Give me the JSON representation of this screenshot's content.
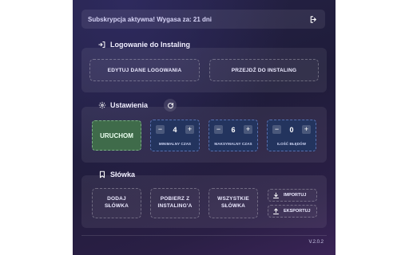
{
  "banner": {
    "text": "Subskrypcja aktywna! Wygasa za: 21 dni"
  },
  "login": {
    "title": "Logowanie do Instaling",
    "edit_label": "EDYTUJ DANE LOGOWANIA",
    "goto_label": "PRZEJDŹ DO INSTALING"
  },
  "settings": {
    "title": "Ustawienia",
    "start_label": "URUCHOM",
    "steppers": [
      {
        "value": "4",
        "label": "MINIMALNY CZAS"
      },
      {
        "value": "6",
        "label": "MAKSYMALNY CZAS"
      },
      {
        "value": "0",
        "label": "ILOŚĆ BŁĘDÓW"
      }
    ],
    "minus": "−",
    "plus": "+"
  },
  "words": {
    "title": "Słówka",
    "add_label": "DODAJ SŁÓWKA",
    "fetch_label": "POBIERZ Z INSTALING'A",
    "all_label": "WSZYSTKIE SŁÓWKA",
    "import_label": "IMPORTUJ",
    "export_label": "EKSPORTUJ"
  },
  "version": "V.2.0.2",
  "colors": {
    "panel": "#262347",
    "start": "#3f6b4a",
    "stepper": "#23345e"
  },
  "icons": [
    "logout-icon",
    "login-icon",
    "gear-icon",
    "refresh-icon",
    "bookmark-icon",
    "download-icon",
    "upload-icon"
  ]
}
